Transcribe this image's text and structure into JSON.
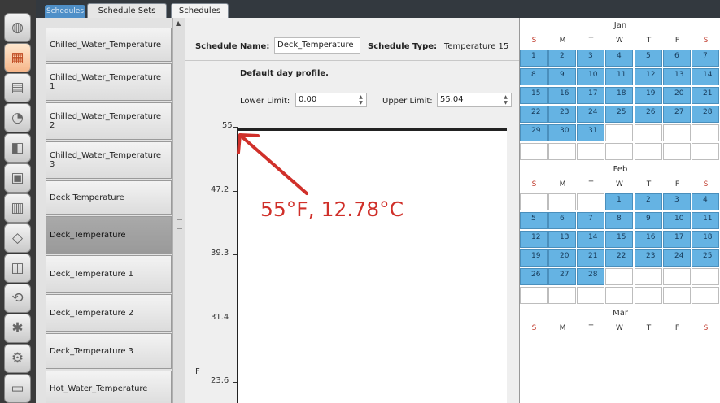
{
  "tabs": {
    "faded": "Schedules",
    "schedule_sets": "Schedule Sets",
    "schedules": "Schedules"
  },
  "rail_icons": [
    "globe-icon",
    "calendar-icon",
    "building-icon",
    "gauge-icon",
    "box-icon",
    "facade-icon",
    "elevation-icon",
    "layer-icon",
    "cube-icon",
    "loop-icon",
    "fan-icon",
    "gear-icon",
    "monitor-icon"
  ],
  "list": {
    "items": [
      "Chilled_Water_Temperature",
      "Chilled_Water_Temperature 1",
      "Chilled_Water_Temperature 2",
      "Chilled_Water_Temperature 3",
      "Deck Temperature",
      "Deck_Temperature",
      "Deck_Temperature 1",
      "Deck_Temperature 2",
      "Deck_Temperature 3",
      "Hot_Water_Temperature"
    ],
    "selected_index": 5
  },
  "detail": {
    "schedule_name_label": "Schedule Name:",
    "schedule_name_value": "Deck_Temperature",
    "schedule_type_label": "Schedule Type:",
    "schedule_type_value": "Temperature 15",
    "profile_title": "Default day profile.",
    "lower_limit_label": "Lower Limit:",
    "lower_limit_value": "0.00",
    "upper_limit_label": "Upper Limit:",
    "upper_limit_value": "55.04"
  },
  "plot": {
    "y_ticks": [
      "55",
      "47.2",
      "39.3",
      "31.4",
      "23.6"
    ],
    "unit_label": "F"
  },
  "annotation": {
    "text": "55°F, 12.78°C",
    "color": "#d0302a"
  },
  "calendar": {
    "weekdays": [
      "S",
      "M",
      "T",
      "W",
      "T",
      "F",
      "S"
    ],
    "months": [
      {
        "name": "Jan",
        "start": 0,
        "days": 31
      },
      {
        "name": "Feb",
        "start": 3,
        "days": 28
      },
      {
        "name": "Mar",
        "start": 3,
        "days": 31
      }
    ],
    "highlight": "#65b3e3"
  }
}
